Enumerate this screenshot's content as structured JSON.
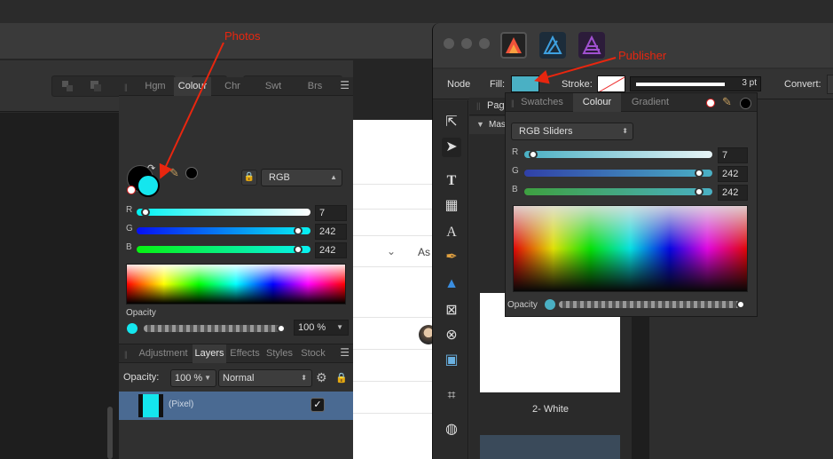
{
  "annotations": {
    "photos": "Photos",
    "publisher": "Publisher"
  },
  "doc_bg": {
    "chevron": "⌄",
    "as_text": "As"
  },
  "photos": {
    "toolbar_icons": [
      "arrange-back-icon",
      "arrange-backward-icon",
      "arrange-forward-icon",
      "arrange-front-icon",
      "align-icon",
      "boolean-add-icon",
      "boolean-subtract-icon",
      "boolean-intersect-icon"
    ],
    "colour_panel": {
      "tabs": [
        "Hgm",
        "Colour",
        "Chr",
        "Swt",
        "Brs"
      ],
      "active_tab": "Colour",
      "mode": "RGB",
      "fill_color": "#14e6ee",
      "sliders": [
        {
          "label": "R",
          "value": "7",
          "fraction": 0.027
        },
        {
          "label": "G",
          "value": "242",
          "fraction": 0.949
        },
        {
          "label": "B",
          "value": "242",
          "fraction": 0.949
        }
      ],
      "opacity_label": "Opacity",
      "opacity_value": "100 %"
    },
    "layers_panel": {
      "tabs": [
        "Adjustment",
        "Layers",
        "Effects",
        "Styles",
        "Stock"
      ],
      "active_tab": "Layers",
      "opacity_label": "Opacity:",
      "opacity_value": "100 %",
      "blend_mode": "Normal",
      "layer_name": "(Pixel)",
      "layer_checked": "✓"
    }
  },
  "publisher": {
    "context": {
      "node_label": "Node",
      "fill_label": "Fill:",
      "fill_color": "#4ab0c4",
      "stroke_label": "Stroke:",
      "stroke_width": "3 pt",
      "convert_label": "Convert:"
    },
    "pages_panel": {
      "tab": "Page",
      "section": "Mas",
      "page_label": "2- White"
    },
    "colour_panel": {
      "tabs": [
        "Swatches",
        "Colour",
        "Gradient"
      ],
      "active_tab": "Colour",
      "mode": "RGB Sliders",
      "sliders": [
        {
          "label": "R",
          "value": "7",
          "fraction": 0.027
        },
        {
          "label": "G",
          "value": "242",
          "fraction": 0.949
        },
        {
          "label": "B",
          "value": "242",
          "fraction": 0.949
        }
      ],
      "opacity_label": "Opacity"
    }
  }
}
